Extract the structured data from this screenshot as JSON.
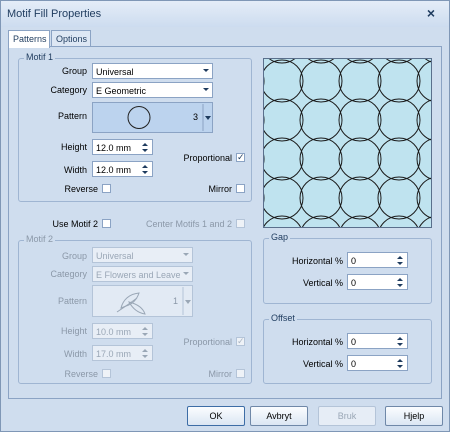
{
  "window": {
    "title": "Motif Fill Properties"
  },
  "tabs": [
    {
      "label": "Patterns",
      "active": true
    },
    {
      "label": "Options",
      "active": false
    }
  ],
  "motif1": {
    "title": "Motif 1",
    "group_label": "Group",
    "group_value": "Universal",
    "category_label": "Category",
    "category_value": "E Geometric",
    "pattern_label": "Pattern",
    "pattern_number": "3",
    "height_label": "Height",
    "height_value": "12.0 mm",
    "width_label": "Width",
    "width_value": "12.0 mm",
    "proportional_label": "Proportional",
    "proportional_checked": true,
    "reverse_label": "Reverse",
    "reverse_checked": false,
    "mirror_label": "Mirror",
    "mirror_checked": false
  },
  "use_motif2": {
    "label": "Use Motif 2",
    "checked": false
  },
  "center_motifs": {
    "label": "Center Motifs 1 and 2",
    "checked": false
  },
  "motif2": {
    "title": "Motif 2",
    "group_label": "Group",
    "group_value": "Universal",
    "category_label": "Category",
    "category_value": "E Flowers and Leaves",
    "pattern_label": "Pattern",
    "pattern_number": "1",
    "height_label": "Height",
    "height_value": "10.0 mm",
    "width_label": "Width",
    "width_value": "17.0 mm",
    "proportional_label": "Proportional",
    "proportional_checked": true,
    "reverse_label": "Reverse",
    "reverse_checked": false,
    "mirror_label": "Mirror",
    "mirror_checked": false
  },
  "gap": {
    "title": "Gap",
    "horizontal_label": "Horizontal %",
    "horizontal_value": "0",
    "vertical_label": "Vertical %",
    "vertical_value": "0"
  },
  "offset": {
    "title": "Offset",
    "horizontal_label": "Horizontal %",
    "horizontal_value": "0",
    "vertical_label": "Vertical %",
    "vertical_value": "0"
  },
  "buttons": {
    "ok": "OK",
    "cancel": "Avbryt",
    "apply": "Bruk",
    "help": "Hjelp"
  },
  "colors": {
    "preview_fill": "#bfe3ef",
    "dialog_bg": "#cfddee",
    "pattern_selected_bg": "#bcd3ee"
  },
  "icons": {
    "close": "close-icon",
    "preview": "circle-motif-preview"
  }
}
